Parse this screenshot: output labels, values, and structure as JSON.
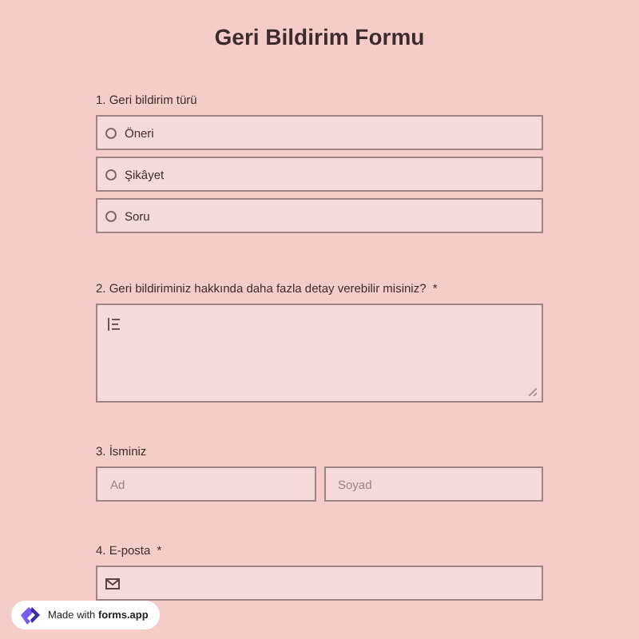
{
  "title": "Geri Bildirim Formu",
  "questions": [
    {
      "kind": "radio",
      "label": "1.  Geri bildirim türü",
      "options": [
        {
          "label": "Öneri",
          "selected": false
        },
        {
          "label": "Şikâyet",
          "selected": false
        },
        {
          "label": "Soru",
          "selected": false
        }
      ]
    },
    {
      "kind": "textarea",
      "label": "2. Geri bildiriminiz hakkında daha fazla detay verebilir misiniz?",
      "required_mark": "*"
    },
    {
      "kind": "name",
      "label": "3. İsminiz",
      "fields": [
        {
          "placeholder": "Ad"
        },
        {
          "placeholder": "Soyad"
        }
      ]
    },
    {
      "kind": "email",
      "label": "4. E-posta",
      "required_mark": "*"
    }
  ],
  "badge": {
    "text": "Made with **forms.app**"
  }
}
